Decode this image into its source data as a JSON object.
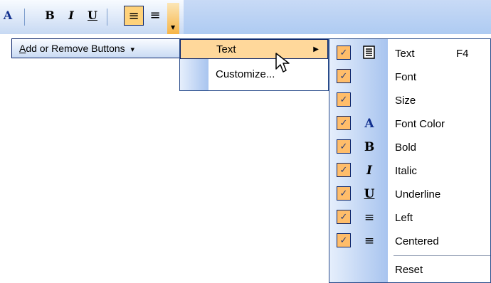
{
  "toolbar": {
    "font_color_glyph": "A",
    "bold_glyph": "B",
    "italic_glyph": "I",
    "underline_glyph": "U",
    "align_left_glyph": "≡",
    "align_center_glyph": "≡"
  },
  "add_remove": {
    "label_prefix": "A",
    "label_rest": "dd or Remove Buttons",
    "arrow": "▾"
  },
  "menu1": {
    "items": [
      {
        "label": "Text",
        "arrow": "▶"
      },
      {
        "label": "Customize..."
      }
    ]
  },
  "menu2": {
    "items": [
      {
        "icon": "text-icon",
        "label": "Text",
        "shortcut": "F4"
      },
      {
        "icon": "",
        "label": "Font"
      },
      {
        "icon": "",
        "label": "Size"
      },
      {
        "icon": "font-color-icon",
        "glyph": "A",
        "label": "Font Color"
      },
      {
        "icon": "bold-icon",
        "glyph": "B",
        "label": "Bold"
      },
      {
        "icon": "italic-icon",
        "glyph": "I",
        "label": "Italic"
      },
      {
        "icon": "underline-icon",
        "glyph": "U",
        "label": "Underline"
      },
      {
        "icon": "align-left-icon",
        "glyph": "≡",
        "label": "Left"
      },
      {
        "icon": "align-center-icon",
        "glyph": "≡",
        "label": "Centered"
      }
    ],
    "reset": "Reset"
  },
  "colors": {
    "highlight": "#ffd89b",
    "check": "#ffbd6a",
    "border": "#0a246a"
  }
}
